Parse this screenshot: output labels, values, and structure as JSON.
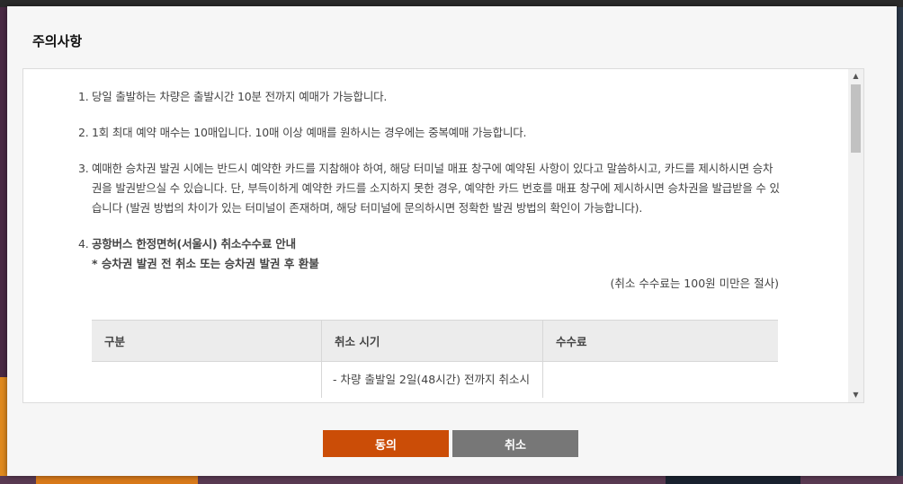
{
  "modal": {
    "title": "주의사항",
    "items": [
      {
        "num": "1.",
        "text": "당일 출발하는 차량은 출발시간 10분 전까지 예매가 가능합니다."
      },
      {
        "num": "2.",
        "text": "1회 최대 예약 매수는 10매입니다. 10매 이상 예매를 원하시는 경우에는 중복예매 가능합니다."
      },
      {
        "num": "3.",
        "text": "예매한 승차권 발권 시에는 반드시 예약한 카드를 지참해야 하여, 해당 터미널 매표 창구에 예약된 사항이 있다고 말씀하시고, 카드를 제시하시면 승차권을 발권받으실 수 있습니다. 단, 부득이하게 예약한 카드를 소지하지 못한 경우, 예약한 카드 번호를 매표 창구에 제시하시면 승차권을 발급받을 수 있습니다 (발권 방법의 차이가 있는 터미널이 존재하며, 해당 터미널에 문의하시면 정확한 발권 방법의 확인이 가능합니다)."
      }
    ],
    "item4": {
      "num": "4.",
      "heading": "공항버스 한정면허(서울시) 취소수수료 안내",
      "subheading": "* 승차권 발권 전 취소 또는 승차권 발권 후 환불",
      "note": "(취소 수수료는 100원 미만은 절사)"
    },
    "table": {
      "headers": [
        "구분",
        "취소 시기",
        "수수료"
      ],
      "rows": [
        [
          "",
          "- 차량 출발일 2일(48시간) 전까지 취소시",
          ""
        ]
      ]
    },
    "buttons": {
      "agree": "동의",
      "cancel": "취소"
    }
  },
  "colors": {
    "agree": "#cb4d07",
    "cancel": "#777777"
  }
}
